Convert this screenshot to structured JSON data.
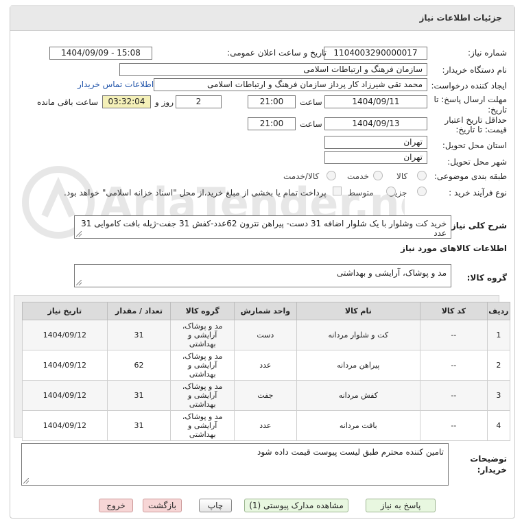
{
  "header": {
    "title": "جزئیات اطلاعات نیاز"
  },
  "form": {
    "need_number_label": "شماره نیاز:",
    "need_number": "1104003290000017",
    "announce_label": "تاریخ و ساعت اعلان عمومی:",
    "announce_value": "1404/09/09 - 15:08",
    "buyer_org_label": "نام دستگاه خریدار:",
    "buyer_org": "سازمان فرهنگ و ارتباطات اسلامی",
    "creator_label": "ایجاد کننده درخواست:",
    "creator": "محمد تقی شیرزاد کار پرداز  سازمان فرهنگ و ارتباطات اسلامی",
    "contact_link": "اطلاعات تماس خریدار",
    "deadline_label_1": "مهلت ارسال پاسخ: تا",
    "deadline_label_2": "تاریخ:",
    "deadline_date": "1404/09/11",
    "time_label": "ساعت",
    "deadline_time": "21:00",
    "days_value": "2",
    "days_label": "روز و",
    "remaining_time": "03:32:04",
    "remaining_label": "ساعت باقی مانده",
    "validity_label_1": "حداقل تاریخ اعتبار",
    "validity_label_2": "قیمت: تا تاریخ:",
    "validity_date": "1404/09/13",
    "validity_time": "21:00",
    "province_label": "استان محل تحویل:",
    "province": "تهران",
    "city_label": "شهر محل تحویل:",
    "city": "تهران",
    "category_label": "طبقه بندی موضوعی:",
    "category_options": [
      "کالا",
      "خدمت",
      "کالا/خدمت"
    ],
    "purchase_type_label": "نوع فرآیند خرید :",
    "purchase_options": [
      "جزیی",
      "متوسط"
    ],
    "payment_note": "پرداخت تمام یا بخشی از مبلغ خرید،از محل \"اسناد خزانه اسلامی\" خواهد بود."
  },
  "description": {
    "label": "شرح کلی نیاز:",
    "text": "خرید کت وشلوار با یک شلوار اضافه 31 دست- پیراهن نترون 62عدد-کفش 31 جفت-ژیله بافت کاموایی 31 عدد"
  },
  "goods_info": {
    "title": "اطلاعات کالاهای مورد نیاز",
    "group_label": "گروه کالا:",
    "group_value": "مد و پوشاک، آرایشی و بهداشتی"
  },
  "table": {
    "headers": [
      "ردیف",
      "کد کالا",
      "نام کالا",
      "واحد شمارش",
      "گروه کالا",
      "تعداد / مقدار",
      "تاریخ نیاز"
    ],
    "rows": [
      {
        "idx": "1",
        "code": "--",
        "name": "کت و شلوار مردانه",
        "unit": "دست",
        "group": "مد و پوشاک، آرایشی و بهداشتی",
        "qty": "31",
        "date": "1404/09/12"
      },
      {
        "idx": "2",
        "code": "--",
        "name": "پیراهن مردانه",
        "unit": "عدد",
        "group": "مد و پوشاک، آرایشی و بهداشتی",
        "qty": "62",
        "date": "1404/09/12"
      },
      {
        "idx": "3",
        "code": "--",
        "name": "کفش مردانه",
        "unit": "جفت",
        "group": "مد و پوشاک، آرایشی و بهداشتی",
        "qty": "31",
        "date": "1404/09/12"
      },
      {
        "idx": "4",
        "code": "--",
        "name": "بافت مردانه",
        "unit": "عدد",
        "group": "مد و پوشاک، آرایشی و بهداشتی",
        "qty": "31",
        "date": "1404/09/12"
      }
    ]
  },
  "notes": {
    "label_1": "توضیحات",
    "label_2": "خریدار:",
    "text": "تامین کننده محترم طبق لیست پیوست قیمت داده شود"
  },
  "buttons": {
    "reply": "پاسخ به نیاز",
    "attachments": "مشاهده مدارک پیوستی (1)",
    "print": "چاپ",
    "back": "بازگشت",
    "exit": "خروج"
  },
  "watermark": {
    "text": "AriaTender.net"
  },
  "colors": {
    "link": "#2255aa",
    "remaining_bg": "#f4f0b8",
    "header_bg": "#e9e9e9"
  }
}
